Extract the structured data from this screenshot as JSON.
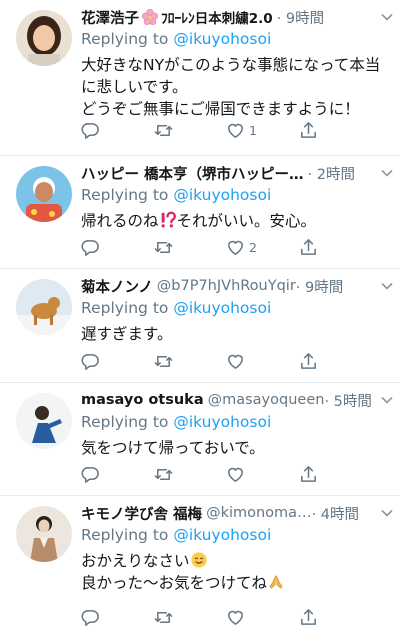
{
  "colors": {
    "link": "#1da1f2",
    "muted": "#657786",
    "text": "#14171a",
    "divider": "#e6ecf0"
  },
  "tweets": [
    {
      "name": "花澤浩子",
      "name_suffix": "ﾌﾛｰﾚﾝ日本刺繍2.0",
      "handle": "",
      "time": "· 9時間",
      "replying_prefix": "Replying to",
      "replying_handle": "@ikuyohosoi",
      "text": "大好きなNYがこのような事態になって本当に悲しいです。\nどうぞご無事にご帰国できますように！",
      "like_count": "1",
      "reply_count": "",
      "retweet_count": ""
    },
    {
      "name": "ハッピー 橋本亨（堺市ハッピー…",
      "handle": "",
      "time": "· 2時間",
      "replying_prefix": "Replying to",
      "replying_handle": "@ikuyohosoi",
      "text_before": "帰れるのね",
      "text_after": "それがいい。安心。",
      "like_count": "2"
    },
    {
      "name": "菊本ノンノ",
      "handle": "@b7P7hJVhRouYqir",
      "time": "· 9時間",
      "replying_prefix": "Replying to",
      "replying_handle": "@ikuyohosoi",
      "text": "遅すぎます。",
      "like_count": ""
    },
    {
      "name": "masayo otsuka",
      "handle": "@masayoqueen",
      "time": "· 5時間",
      "replying_prefix": "Replying to",
      "replying_handle": "@ikuyohosoi",
      "text": "気をつけて帰っておいで。",
      "like_count": ""
    },
    {
      "name": "キモノ学び舎 福梅",
      "handle": "@kimonoma…",
      "time": "· 4時間",
      "replying_prefix": "Replying to",
      "replying_handle": "@ikuyohosoi",
      "text_line1": "おかえりなさい",
      "text_line2": "良かった〜お気をつけてね",
      "like_count": ""
    }
  ]
}
